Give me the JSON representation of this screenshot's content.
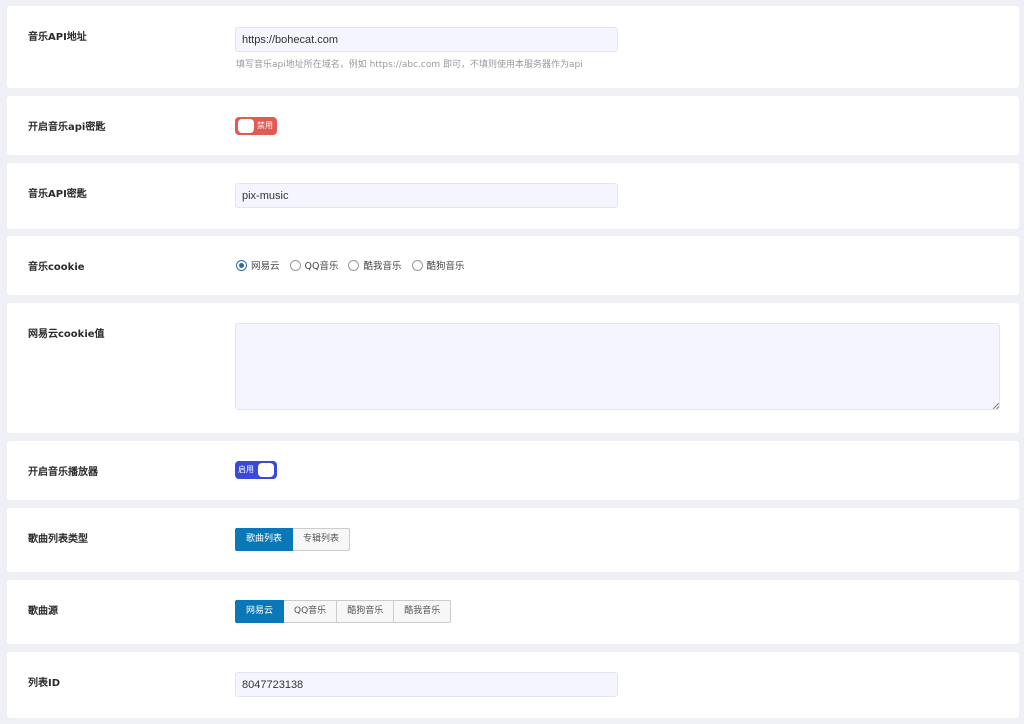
{
  "api_url": {
    "label": "音乐API地址",
    "value": "https://bohecat.com",
    "hint": "填写音乐api地址所在域名，例如 https://abc.com 即可，不填则使用本服务器作为api"
  },
  "api_key_toggle": {
    "label": "开启音乐api密匙",
    "state_text": "禁用",
    "enabled": false
  },
  "api_key": {
    "label": "音乐API密匙",
    "value": "pix-music"
  },
  "cookie_source": {
    "label": "音乐cookie",
    "options": [
      "网易云",
      "QQ音乐",
      "酷我音乐",
      "酷狗音乐"
    ],
    "selected": "网易云"
  },
  "netease_cookie": {
    "label": "网易云cookie值",
    "value": ""
  },
  "player_toggle": {
    "label": "开启音乐播放器",
    "state_text": "启用",
    "enabled": true
  },
  "list_type": {
    "label": "歌曲列表类型",
    "options": [
      "歌曲列表",
      "专辑列表"
    ],
    "selected": "歌曲列表"
  },
  "song_source": {
    "label": "歌曲源",
    "options": [
      "网易云",
      "QQ音乐",
      "酷狗音乐",
      "酷我音乐"
    ],
    "selected": "网易云"
  },
  "list_id": {
    "label": "列表ID",
    "value": "8047723138"
  },
  "colors": {
    "accent_blue": "#0a78b8",
    "toggle_on": "#3a4ad8",
    "toggle_off": "#e25a52"
  }
}
